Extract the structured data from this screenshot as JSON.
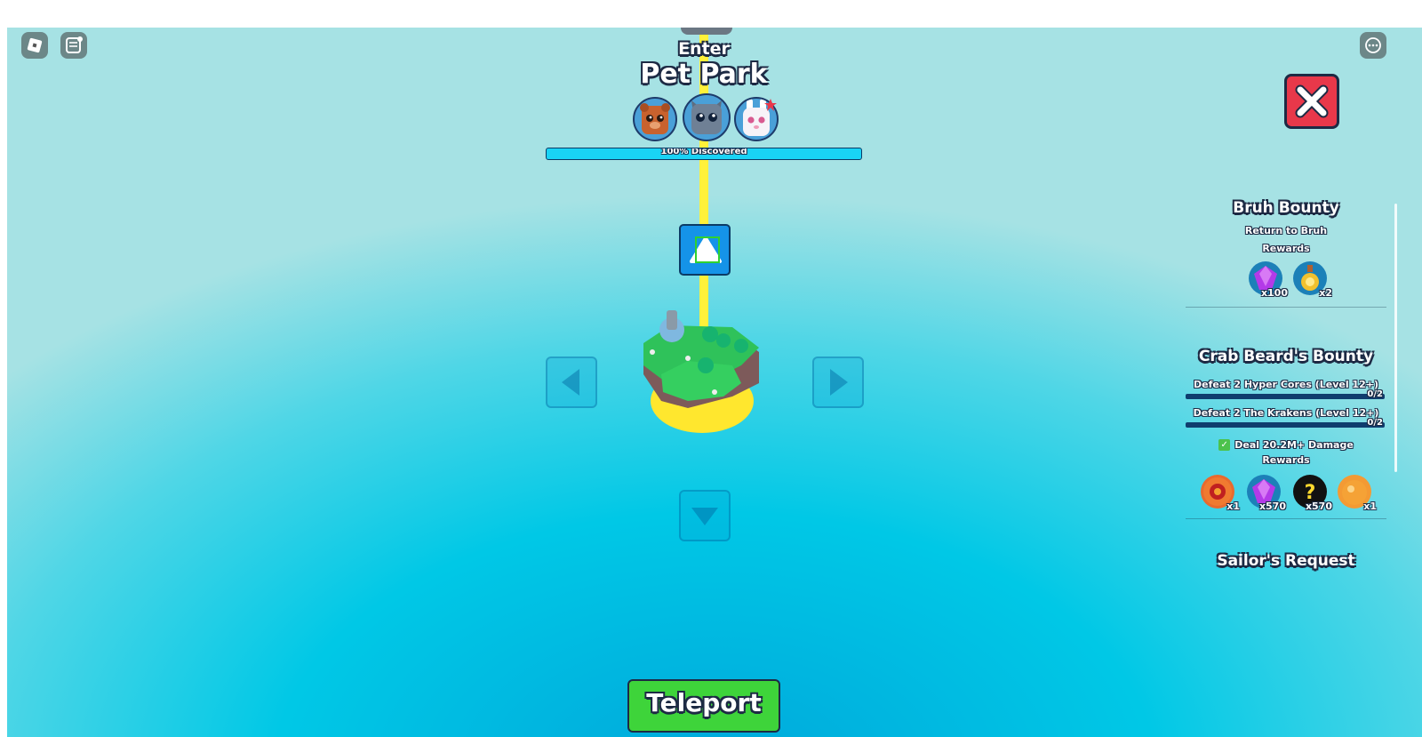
{
  "map": {
    "enter_label": "Enter",
    "zone_name": "Pet Park",
    "discovered_text": "100% Discovered",
    "discovered_progress": 1.0,
    "pets": [
      "bear-pet",
      "cat-pet",
      "bunny-pet"
    ]
  },
  "teleport": {
    "label": "Teleport"
  },
  "quests": {
    "bruh": {
      "title": "Bruh Bounty",
      "subtitle": "Return to Bruh",
      "rewards_label": "Rewards",
      "rewards": [
        {
          "icon": "purple-gem-icon",
          "count": "x100"
        },
        {
          "icon": "potion-icon",
          "count": "x2"
        }
      ]
    },
    "crab": {
      "title": "Crab Beard's Bounty",
      "tasks": [
        {
          "label": "Defeat 2 Hyper Cores (Level 12+)",
          "progress": "0/2"
        },
        {
          "label": "Defeat 2 The Krakens (Level 12+)",
          "progress": "0/2"
        }
      ],
      "completed_task": "Deal 20.2M+ Damage",
      "rewards_label": "Rewards",
      "rewards": [
        {
          "icon": "red-core-icon",
          "count": "x1"
        },
        {
          "icon": "purple-gem-icon",
          "count": "x570"
        },
        {
          "icon": "mystery-icon",
          "count": "x570"
        },
        {
          "icon": "orange-egg-icon",
          "count": "x1"
        }
      ]
    },
    "sailor": {
      "title": "Sailor's Request"
    }
  },
  "colors": {
    "path": "#fff13a",
    "progress_fill": "#19d3f5",
    "close_button": "#e8384a",
    "teleport_button": "#3ed43a"
  }
}
